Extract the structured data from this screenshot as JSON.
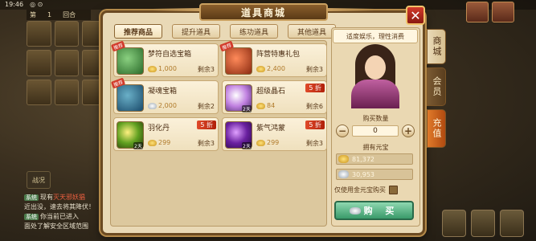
{
  "status_bar": {
    "time": "19:46",
    "icons": "◎ ⊙"
  },
  "round": {
    "label_left": "第",
    "number": "1",
    "label_right": "回合"
  },
  "battle_button": "战况",
  "chat": [
    {
      "tag": "系统",
      "text": "现有",
      "highlight": "灭天邪妖猖",
      "rest": ""
    },
    {
      "tag": "",
      "text": "近出没，速去将其降伏！",
      "highlight": "",
      "rest": ""
    },
    {
      "tag": "系统",
      "text": "你当前已进入",
      "highlight": "",
      "rest": ""
    },
    {
      "tag": "",
      "text": "面处了解安全区域范围",
      "highlight": "",
      "rest": ""
    }
  ],
  "shop": {
    "title": "道具商城",
    "close_label": "✕",
    "tabs": [
      {
        "label": "推荐商品",
        "active": true
      },
      {
        "label": "提升道具",
        "active": false
      },
      {
        "label": "练功道具",
        "active": false
      },
      {
        "label": "其他道具",
        "active": false
      }
    ],
    "side_tabs": [
      {
        "label": "商城",
        "style": "active"
      },
      {
        "label": "会员",
        "style": "normal"
      },
      {
        "label": "充值",
        "style": "orange"
      }
    ],
    "items": [
      {
        "name": "梦符自选宝箱",
        "price": "1,000",
        "currency": "gold",
        "remain": "剩余3",
        "ribbon": "推荐",
        "days": "",
        "discount": "",
        "icon": "chest-icon"
      },
      {
        "name": "阵营特惠礼包",
        "price": "2,400",
        "currency": "gold",
        "remain": "剩余3",
        "ribbon": "推荐",
        "days": "",
        "discount": "",
        "icon": "gift-bag-icon"
      },
      {
        "name": "凝魂宝箱",
        "price": "2,000",
        "currency": "silver",
        "remain": "剩余2",
        "ribbon": "推荐",
        "days": "",
        "discount": "",
        "icon": "treasure-box-icon"
      },
      {
        "name": "超级晶石",
        "price": "84",
        "currency": "gold",
        "remain": "剩余6",
        "ribbon": "",
        "days": "2天",
        "discount": "5 折",
        "icon": "crystal-icon"
      },
      {
        "name": "羽化丹",
        "price": "299",
        "currency": "gold",
        "remain": "剩余3",
        "ribbon": "",
        "days": "2天",
        "discount": "5 折",
        "icon": "pill-icon"
      },
      {
        "name": "紫气鸿蒙",
        "price": "299",
        "currency": "gold",
        "remain": "剩余3",
        "ribbon": "",
        "days": "2天",
        "discount": "5 折",
        "icon": "purple-orb-icon"
      }
    ],
    "detail": {
      "slogan": "适度娱乐，理性消费",
      "qty_label": "购买数量",
      "qty_value": "0",
      "owned_label": "拥有元宝",
      "gold_amount": "81,372",
      "silver_amount": "30,953",
      "gold_only_label": "仅使用金元宝购买",
      "buy_label": "购 买"
    }
  },
  "colors": {
    "accent_red": "#d23a2a",
    "buy_green": "#3a9a6a",
    "panel_bg": "#e9d9b6"
  }
}
